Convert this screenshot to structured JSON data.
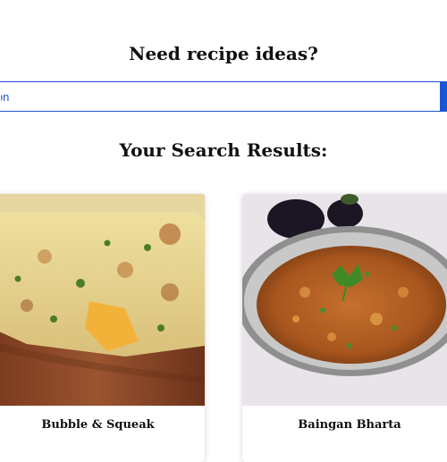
{
  "header": {
    "title": "Need recipe ideas?"
  },
  "search": {
    "visible_text": "ion",
    "placeholder": "ion"
  },
  "results": {
    "title": "Your Search Results:",
    "cards": [
      {
        "title": "Bubble & Squeak",
        "image": "bubble-and-squeak-photo"
      },
      {
        "title": "Baingan Bharta",
        "image": "baingan-bharta-photo"
      }
    ]
  },
  "colors": {
    "accent": "#1a55d6",
    "text": "#111111",
    "background": "#ffffff"
  }
}
